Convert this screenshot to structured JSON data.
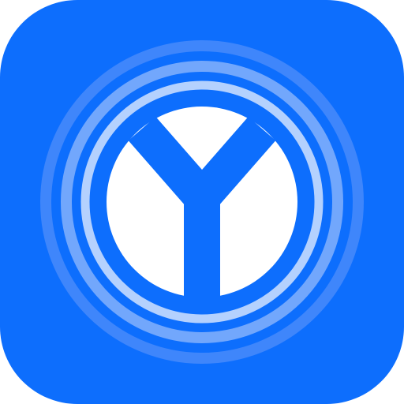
{
  "icon": {
    "name": "Y logo app icon",
    "glyph": "Y",
    "colors": {
      "tile": "#0d6efd",
      "ring_outer": "#3f86fb",
      "ring_middle": "#72a7fc",
      "ring_inner": "#b4d1fe",
      "center_disc": "#ffffff",
      "glyph": "#0d6efd"
    }
  }
}
